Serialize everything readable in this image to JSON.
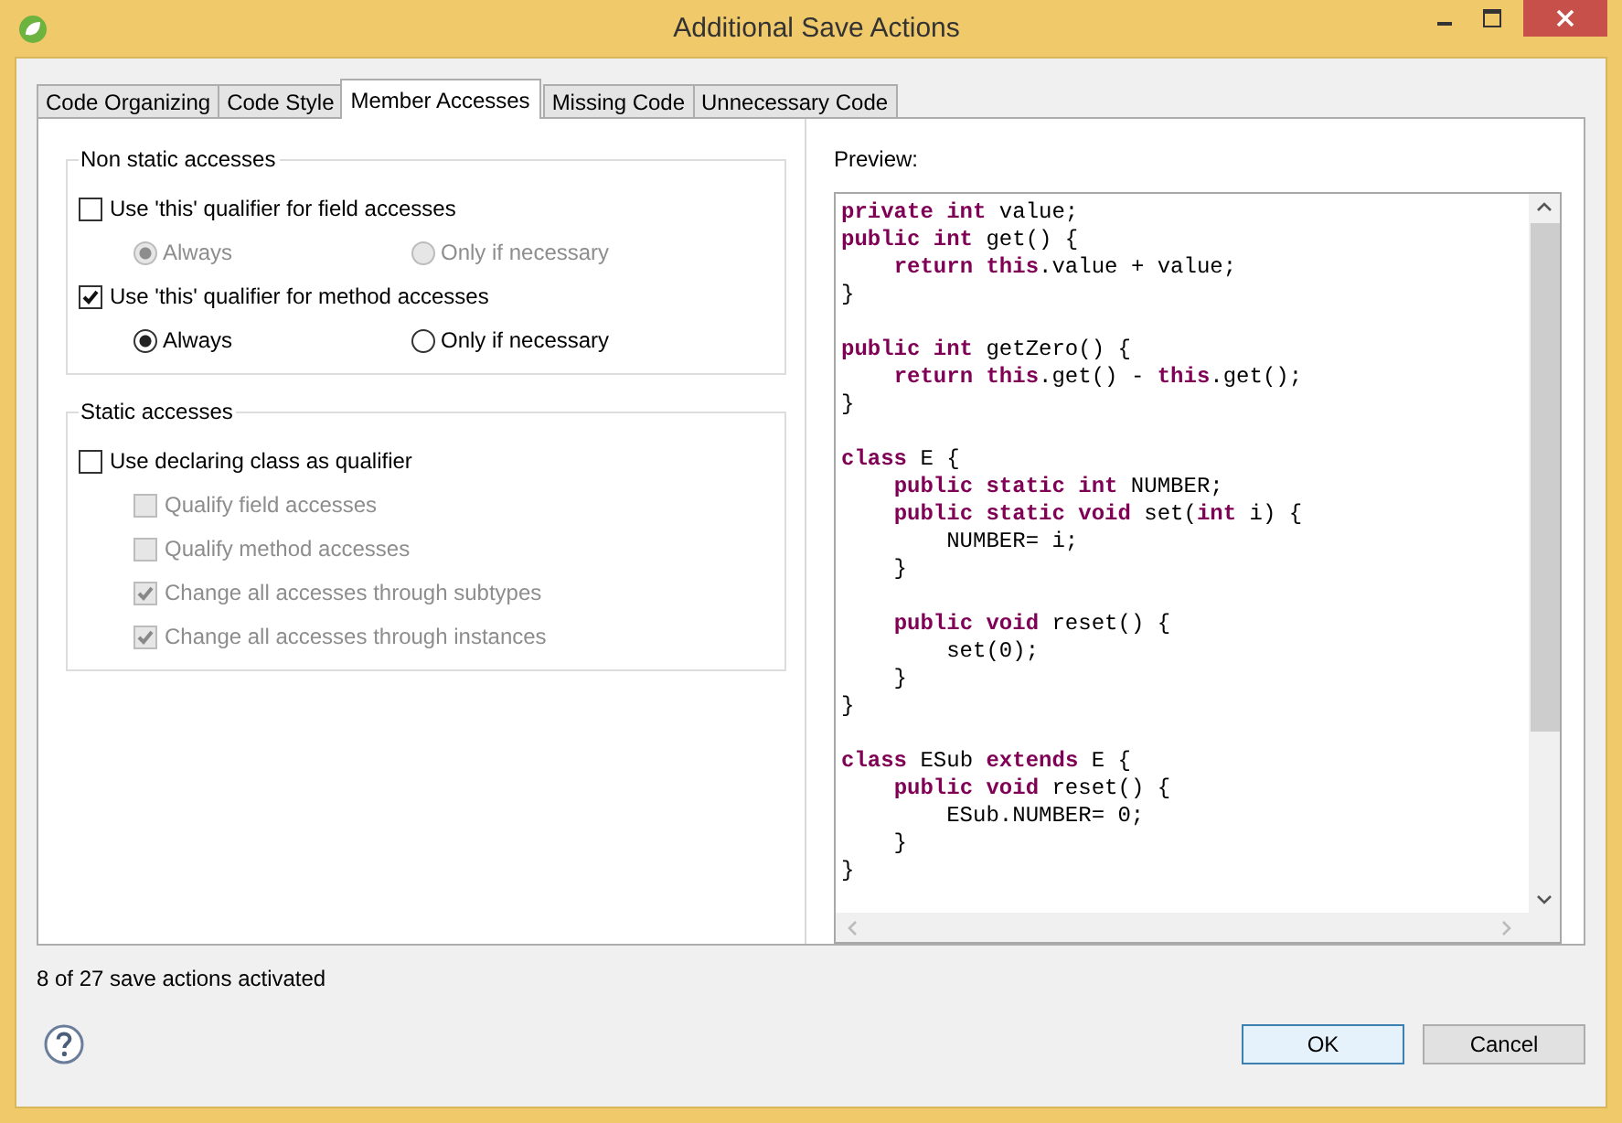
{
  "window": {
    "title": "Additional Save Actions"
  },
  "tabs": [
    {
      "label": "Code Organizing",
      "selected": false
    },
    {
      "label": "Code Style",
      "selected": false
    },
    {
      "label": "Member Accesses",
      "selected": true
    },
    {
      "label": "Missing Code",
      "selected": false
    },
    {
      "label": "Unnecessary Code",
      "selected": false
    }
  ],
  "groups": [
    {
      "title": "Non static accesses",
      "items": [
        {
          "kind": "checkbox",
          "label": "Use 'this' qualifier for field accesses",
          "checked": false,
          "disabled": false,
          "children": [
            {
              "kind": "radio_row",
              "options": [
                {
                  "label": "Always",
                  "selected": true,
                  "disabled": true
                },
                {
                  "label": "Only if necessary",
                  "selected": false,
                  "disabled": true
                }
              ]
            }
          ]
        },
        {
          "kind": "checkbox",
          "label": "Use 'this' qualifier for method accesses",
          "checked": true,
          "disabled": false,
          "children": [
            {
              "kind": "radio_row",
              "options": [
                {
                  "label": "Always",
                  "selected": true,
                  "disabled": false
                },
                {
                  "label": "Only if necessary",
                  "selected": false,
                  "disabled": false
                }
              ]
            }
          ]
        }
      ]
    },
    {
      "title": "Static accesses",
      "items": [
        {
          "kind": "checkbox",
          "label": "Use declaring class as qualifier",
          "checked": false,
          "disabled": false,
          "children": [
            {
              "kind": "checkbox",
              "label": "Qualify field accesses",
              "checked": false,
              "disabled": true
            },
            {
              "kind": "checkbox",
              "label": "Qualify method accesses",
              "checked": false,
              "disabled": true
            },
            {
              "kind": "checkbox",
              "label": "Change all accesses through subtypes",
              "checked": true,
              "disabled": true
            },
            {
              "kind": "checkbox",
              "label": "Change all accesses through instances",
              "checked": true,
              "disabled": true
            }
          ]
        }
      ]
    }
  ],
  "preview": {
    "label": "Preview:",
    "blocks": [
      [
        "**private int** value;",
        "**public int** get() {",
        "    **return this**.value + value;",
        "}"
      ],
      [
        "**public int** getZero() {",
        "    **return this**.get() - **this**.get();",
        "}"
      ],
      [
        "**class** E {",
        "    **public static int** NUMBER;",
        "    **public static void** set(**int** i) {",
        "        NUMBER= i;",
        "    }"
      ],
      [
        "    **public void** reset() {",
        "        set(0);",
        "    }",
        "}"
      ],
      [
        "**class** ESub **extends** E {",
        "    **public void** reset() {",
        "        ESub.NUMBER= 0;",
        "    }",
        "}"
      ]
    ]
  },
  "status": "8 of 27 save actions activated",
  "buttons": [
    {
      "label": "OK",
      "default": true
    },
    {
      "label": "Cancel",
      "default": false
    }
  ]
}
